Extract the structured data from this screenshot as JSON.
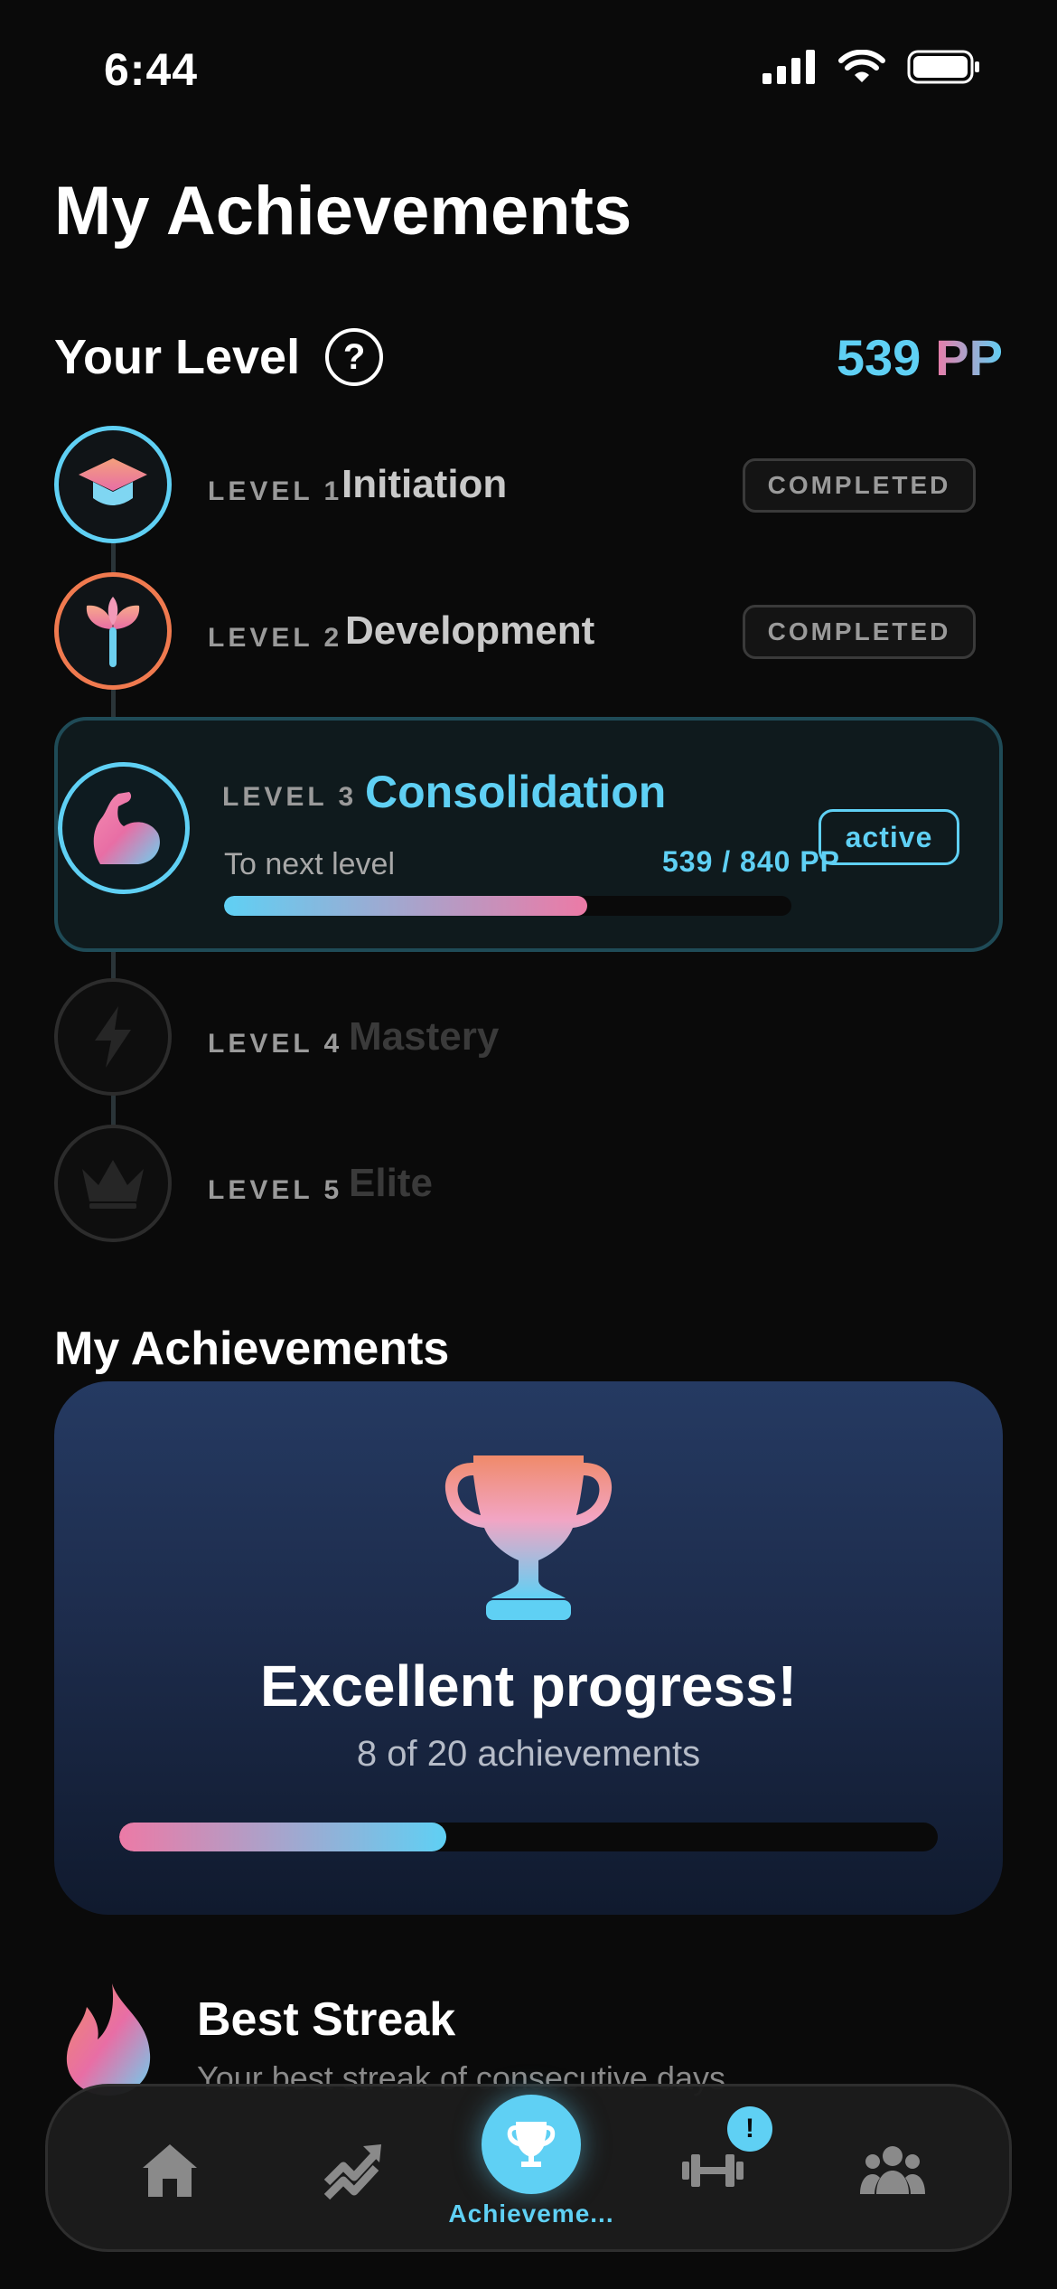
{
  "status_bar": {
    "time": "6:44"
  },
  "page": {
    "title": "My Achievements"
  },
  "level_section": {
    "title": "Your Level",
    "points": "539",
    "points_unit": "PP"
  },
  "levels": [
    {
      "tag": "LEVEL 1",
      "name": "Initiation",
      "status": "COMPLETED",
      "icon": "graduation-cap-icon"
    },
    {
      "tag": "LEVEL 2",
      "name": "Development",
      "status": "COMPLETED",
      "icon": "sprout-icon"
    },
    {
      "tag": "LEVEL 3",
      "name": "Consolidation",
      "status": "active",
      "icon": "flexed-biceps-icon",
      "next_label": "To next level",
      "next_value": "539 / 840 PP",
      "progress": 0.64
    },
    {
      "tag": "LEVEL 4",
      "name": "Mastery",
      "icon": "lightning-icon"
    },
    {
      "tag": "LEVEL 5",
      "name": "Elite",
      "icon": "crown-icon"
    }
  ],
  "achievements": {
    "heading": "My Achievements",
    "title": "Excellent progress!",
    "count_text": "8 of 20 achievements",
    "progress": 0.4
  },
  "streak": {
    "title": "Best Streak",
    "subtitle": "Your best streak of consecutive days"
  },
  "tab_bar": {
    "active_label": "Achieveme...",
    "badge": "!",
    "tabs": [
      "home-icon",
      "trending-icon",
      "trophy-icon",
      "dumbbell-icon",
      "people-icon"
    ]
  },
  "colors": {
    "accent": "#5fd0f4",
    "pink": "#ec7aa6",
    "background": "#0a0a0a"
  }
}
